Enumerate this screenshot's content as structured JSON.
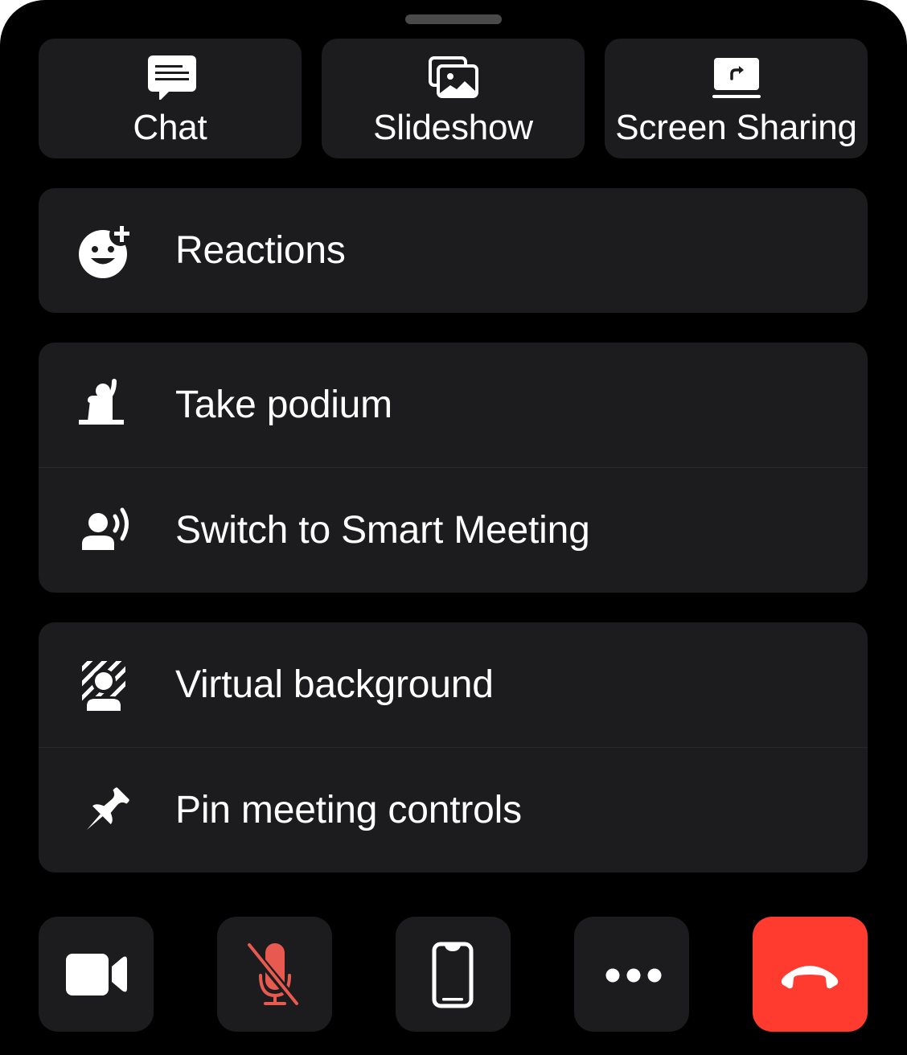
{
  "handle": {
    "icon": "drag-handle"
  },
  "top_actions": [
    {
      "label": "Chat",
      "icon": "chat-bubble-icon"
    },
    {
      "label": "Slideshow",
      "icon": "photos-icon"
    },
    {
      "label": "Screen Sharing",
      "icon": "screen-share-icon"
    }
  ],
  "groups": [
    {
      "items": [
        {
          "label": "Reactions",
          "icon": "reaction-add-icon"
        }
      ]
    },
    {
      "items": [
        {
          "label": "Take podium",
          "icon": "raise-hand-podium-icon"
        },
        {
          "label": "Switch to Smart Meeting",
          "icon": "person-speaking-icon"
        }
      ]
    },
    {
      "items": [
        {
          "label": "Virtual background",
          "icon": "virtual-background-icon"
        },
        {
          "label": "Pin meeting controls",
          "icon": "pin-icon"
        }
      ]
    }
  ],
  "toolbar": {
    "camera": {
      "icon": "video-camera-icon",
      "state": "on"
    },
    "mic": {
      "icon": "mic-muted-icon",
      "state": "muted"
    },
    "device": {
      "icon": "phone-icon"
    },
    "more": {
      "icon": "more-dots-icon"
    },
    "end_call": {
      "icon": "hang-up-icon"
    }
  },
  "colors": {
    "background": "#000000",
    "surface": "#1c1c1e",
    "text": "#ffffff",
    "muted_mic": "#e85a4f",
    "end_call": "#ff3b30",
    "handle": "#4a4a4a"
  }
}
